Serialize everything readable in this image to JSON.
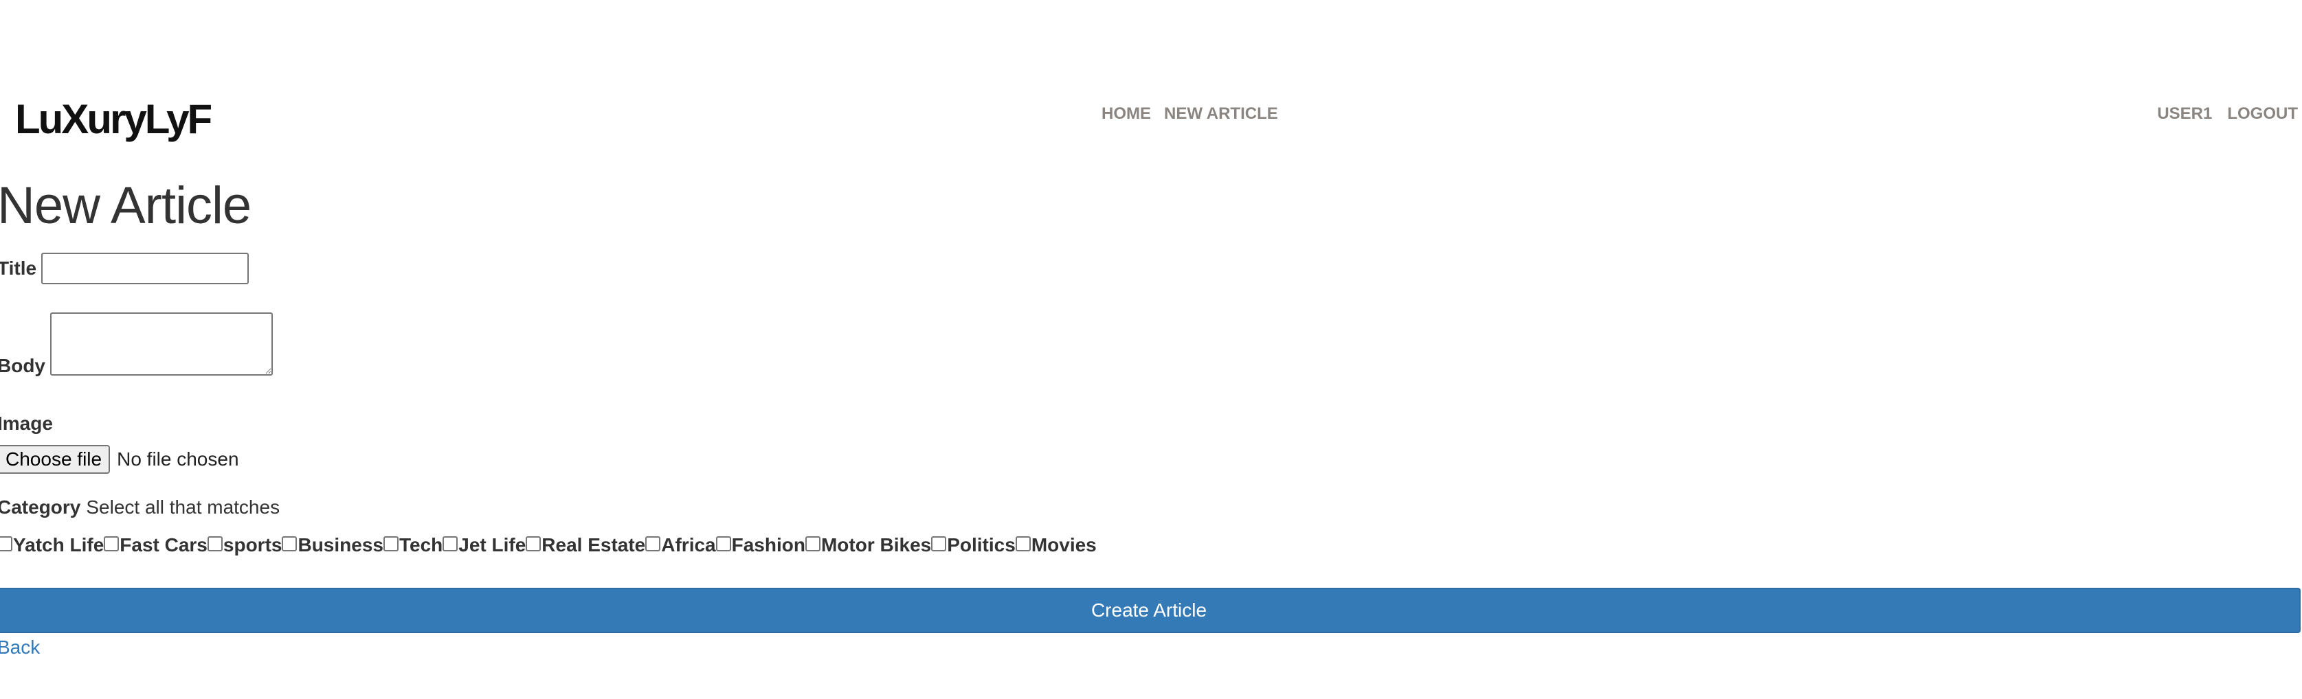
{
  "navbar": {
    "brand": "LuXuryLyF",
    "links": [
      {
        "label": "HOME"
      },
      {
        "label": "NEW ARTICLE"
      }
    ],
    "user_links": [
      {
        "label": "USER1"
      },
      {
        "label": "LOGOUT"
      }
    ]
  },
  "form": {
    "heading": "New Article",
    "title_label": "Title",
    "title_value": "",
    "body_label": "Body",
    "body_value": "",
    "image_label": "Image",
    "file_button_label": "Choose file",
    "file_status": "No file chosen",
    "category_label": "Category",
    "category_hint": "Select all that matches",
    "categories": [
      {
        "label": "Yatch Life",
        "checked": false
      },
      {
        "label": "Fast Cars",
        "checked": false
      },
      {
        "label": "sports",
        "checked": false
      },
      {
        "label": "Business",
        "checked": false
      },
      {
        "label": "Tech",
        "checked": false
      },
      {
        "label": "Jet Life",
        "checked": false
      },
      {
        "label": "Real Estate",
        "checked": false
      },
      {
        "label": "Africa",
        "checked": false
      },
      {
        "label": "Fashion",
        "checked": false
      },
      {
        "label": "Motor Bikes",
        "checked": false
      },
      {
        "label": "Politics",
        "checked": false
      },
      {
        "label": "Movies",
        "checked": false
      }
    ],
    "submit_label": "Create Article",
    "back_label": "Back"
  },
  "colors": {
    "primary": "#337ab7",
    "nav_link": "#8a8581",
    "text": "#333333"
  }
}
